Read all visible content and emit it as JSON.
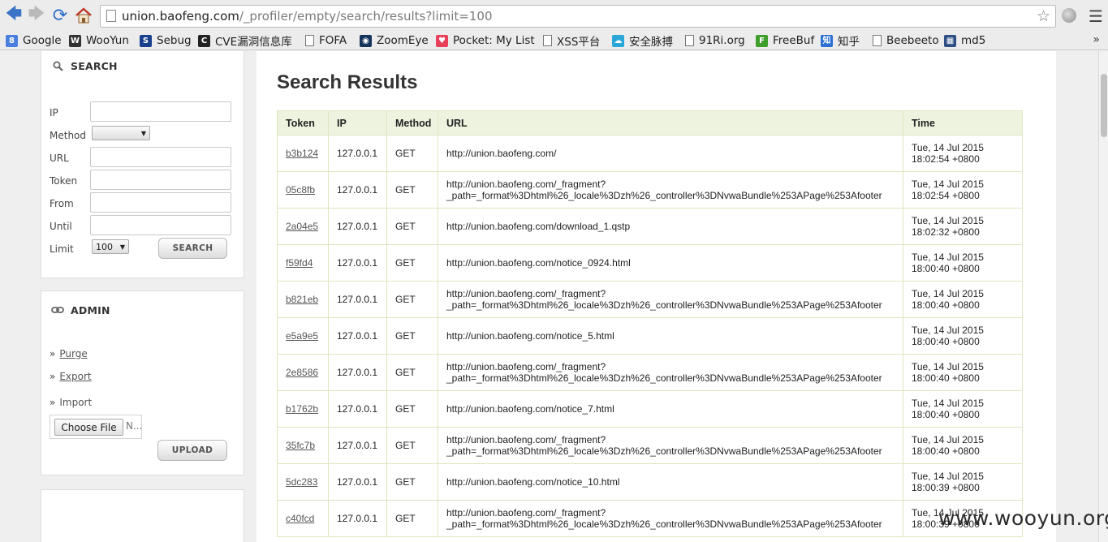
{
  "browser": {
    "url_host": "union.baofeng.com",
    "url_path": "/_profiler/empty/search/results?limit=100",
    "bookmarks": [
      {
        "label": "Google",
        "color": "#4a7fe0",
        "glyph": "8"
      },
      {
        "label": "WooYun",
        "color": "#333333",
        "glyph": "W"
      },
      {
        "label": "Sebug",
        "color": "#1a3f8c",
        "glyph": "S"
      },
      {
        "label": "CVE漏洞信息库",
        "color": "#222222",
        "glyph": "C"
      },
      {
        "label": "FOFA",
        "color": "",
        "glyph": ""
      },
      {
        "label": "ZoomEye",
        "color": "#16345c",
        "glyph": "◉"
      },
      {
        "label": "Pocket: My List",
        "color": "#e8405a",
        "glyph": "♥"
      },
      {
        "label": "XSS平台",
        "color": "",
        "glyph": ""
      },
      {
        "label": "安全脉搏",
        "color": "#2aa6d8",
        "glyph": "☁"
      },
      {
        "label": "91Ri.org",
        "color": "",
        "glyph": ""
      },
      {
        "label": "FreeBuf",
        "color": "#3f9e2c",
        "glyph": "F"
      },
      {
        "label": "知乎",
        "color": "#2a6fd1",
        "glyph": "知"
      },
      {
        "label": "Beebeeto",
        "color": "",
        "glyph": ""
      },
      {
        "label": "md5",
        "color": "#2d4f86",
        "glyph": "▦"
      }
    ],
    "more": "»"
  },
  "search": {
    "title": "SEARCH",
    "icon": "magnifier-icon",
    "labels": {
      "ip": "IP",
      "method": "Method",
      "url": "URL",
      "token": "Token",
      "from": "From",
      "until": "Until",
      "limit": "Limit"
    },
    "method_value": "",
    "limit_value": "100",
    "button": "SEARCH"
  },
  "admin": {
    "title": "ADMIN",
    "icon": "chain-link-icon",
    "purge": "Purge",
    "export": "Export",
    "import": "Import",
    "file_button": "Choose File",
    "file_status": "N...",
    "upload": "UPLOAD"
  },
  "results": {
    "heading": "Search Results",
    "columns": [
      "Token",
      "IP",
      "Method",
      "URL",
      "Time"
    ],
    "rows": [
      {
        "token": "b3b124",
        "ip": "127.0.0.1",
        "method": "GET",
        "url1": "http://union.baofeng.com/",
        "url2": "",
        "time1": "Tue, 14 Jul 2015",
        "time2": "18:02:54 +0800"
      },
      {
        "token": "05c8fb",
        "ip": "127.0.0.1",
        "method": "GET",
        "url1": "http://union.baofeng.com/_fragment?",
        "url2": "_path=_format%3Dhtml%26_locale%3Dzh%26_controller%3DNvwaBundle%253APage%253Afooter",
        "time1": "Tue, 14 Jul 2015",
        "time2": "18:02:54 +0800"
      },
      {
        "token": "2a04e5",
        "ip": "127.0.0.1",
        "method": "GET",
        "url1": "http://union.baofeng.com/download_1.qstp",
        "url2": "",
        "time1": "Tue, 14 Jul 2015",
        "time2": "18:02:32 +0800"
      },
      {
        "token": "f59fd4",
        "ip": "127.0.0.1",
        "method": "GET",
        "url1": "http://union.baofeng.com/notice_0924.html",
        "url2": "",
        "time1": "Tue, 14 Jul 2015",
        "time2": "18:00:40 +0800"
      },
      {
        "token": "b821eb",
        "ip": "127.0.0.1",
        "method": "GET",
        "url1": "http://union.baofeng.com/_fragment?",
        "url2": "_path=_format%3Dhtml%26_locale%3Dzh%26_controller%3DNvwaBundle%253APage%253Afooter",
        "time1": "Tue, 14 Jul 2015",
        "time2": "18:00:40 +0800"
      },
      {
        "token": "e5a9e5",
        "ip": "127.0.0.1",
        "method": "GET",
        "url1": "http://union.baofeng.com/notice_5.html",
        "url2": "",
        "time1": "Tue, 14 Jul 2015",
        "time2": "18:00:40 +0800"
      },
      {
        "token": "2e8586",
        "ip": "127.0.0.1",
        "method": "GET",
        "url1": "http://union.baofeng.com/_fragment?",
        "url2": "_path=_format%3Dhtml%26_locale%3Dzh%26_controller%3DNvwaBundle%253APage%253Afooter",
        "time1": "Tue, 14 Jul 2015",
        "time2": "18:00:40 +0800"
      },
      {
        "token": "b1762b",
        "ip": "127.0.0.1",
        "method": "GET",
        "url1": "http://union.baofeng.com/notice_7.html",
        "url2": "",
        "time1": "Tue, 14 Jul 2015",
        "time2": "18:00:40 +0800"
      },
      {
        "token": "35fc7b",
        "ip": "127.0.0.1",
        "method": "GET",
        "url1": "http://union.baofeng.com/_fragment?",
        "url2": "_path=_format%3Dhtml%26_locale%3Dzh%26_controller%3DNvwaBundle%253APage%253Afooter",
        "time1": "Tue, 14 Jul 2015",
        "time2": "18:00:40 +0800"
      },
      {
        "token": "5dc283",
        "ip": "127.0.0.1",
        "method": "GET",
        "url1": "http://union.baofeng.com/notice_10.html",
        "url2": "",
        "time1": "Tue, 14 Jul 2015",
        "time2": "18:00:39 +0800"
      },
      {
        "token": "c40fcd",
        "ip": "127.0.0.1",
        "method": "GET",
        "url1": "http://union.baofeng.com/_fragment?",
        "url2": "_path=_format%3Dhtml%26_locale%3Dzh%26_controller%3DNvwaBundle%253APage%253Afooter",
        "time1": "Tue, 14 Jul 2015",
        "time2": "18:00:39 +0800"
      }
    ]
  },
  "watermark": "www.wooyun.org"
}
